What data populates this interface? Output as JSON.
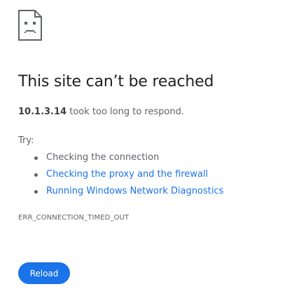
{
  "icon": "sad-page-icon",
  "title": "This site can’t be reached",
  "description": {
    "host": "10.1.3.14",
    "message": " took too long to respond."
  },
  "try_label": "Try:",
  "suggestions": [
    {
      "label": "Checking the connection",
      "link": false
    },
    {
      "label": "Checking the proxy and the firewall",
      "link": true
    },
    {
      "label": "Running Windows Network Diagnostics",
      "link": true
    }
  ],
  "error_code": "ERR_CONNECTION_TIMED_OUT",
  "reload_label": "Reload",
  "colors": {
    "accent": "#1a73e8",
    "text": "#202124",
    "secondary_text": "#5f6368"
  }
}
